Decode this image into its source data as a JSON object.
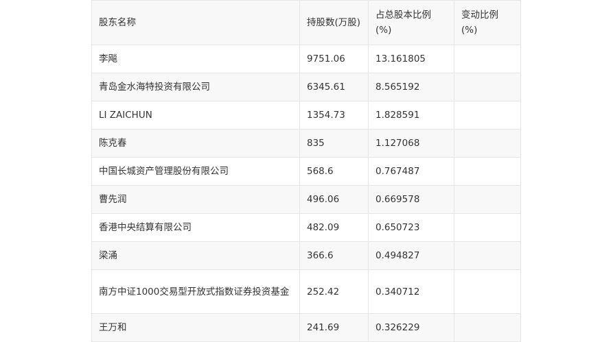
{
  "table": {
    "headers": [
      "股东名称",
      "持股数(万股)",
      "占总股本比例(%)",
      "变动比例(%)"
    ],
    "rows": [
      {
        "name": "李飚",
        "shares": "9751.06",
        "ratio": "13.161805",
        "change": ""
      },
      {
        "name": "青岛金水海特投资有限公司",
        "shares": "6345.61",
        "ratio": "8.565192",
        "change": ""
      },
      {
        "name": "LI ZAICHUN",
        "shares": "1354.73",
        "ratio": "1.828591",
        "change": ""
      },
      {
        "name": "陈克春",
        "shares": "835",
        "ratio": "1.127068",
        "change": ""
      },
      {
        "name": "中国长城资产管理股份有限公司",
        "shares": "568.6",
        "ratio": "0.767487",
        "change": ""
      },
      {
        "name": "曹先润",
        "shares": "496.06",
        "ratio": "0.669578",
        "change": ""
      },
      {
        "name": "香港中央结算有限公司",
        "shares": "482.09",
        "ratio": "0.650723",
        "change": ""
      },
      {
        "name": "梁涌",
        "shares": "366.6",
        "ratio": "0.494827",
        "change": ""
      },
      {
        "name": "南方中证1000交易型开放式指数证券投资基金",
        "shares": "252.42",
        "ratio": "0.340712",
        "change": ""
      },
      {
        "name": "王万和",
        "shares": "241.69",
        "ratio": "0.326229",
        "change": ""
      }
    ]
  }
}
